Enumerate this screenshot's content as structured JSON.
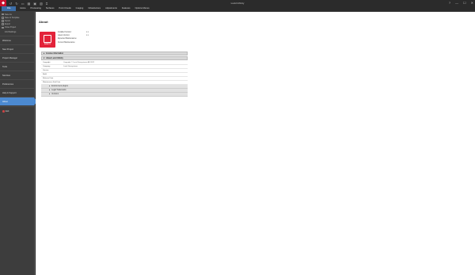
{
  "window": {
    "title": "Lucid Infinity"
  },
  "qat": [
    "↺",
    "↻",
    "▭",
    "▦",
    "▣",
    "▧",
    "⌗"
  ],
  "ribbon_tabs": [
    "File",
    "Home",
    "Processing",
    "Surfaces",
    "Point Clouds",
    "Imaging",
    "Infrastructure",
    "Adjustments",
    "Features",
    "Options Menus"
  ],
  "left": {
    "small_items": [
      "Save As",
      "Save to Template",
      "Import",
      "Export",
      "Close Project"
    ],
    "recent_label": "Info Buildings",
    "nav": [
      "Welcome",
      "New Project",
      "Project Manager",
      "Tools",
      "Services",
      "Preferences",
      "Help & Support",
      "About"
    ],
    "active": "About",
    "exit": "Exit"
  },
  "main": {
    "title": "About",
    "logo_text": "INFINITY",
    "versions": [
      {
        "label": "Installed Version:",
        "value": "x.x"
      },
      {
        "label": "Latest Version:",
        "value": "x.x"
      },
      {
        "label": "Expected Maintenance:",
        "value": ""
      },
      {
        "label": "Current Maintenance:",
        "value": ""
      }
    ],
    "section_license": "License information",
    "section_about": "About Lucid Infinity",
    "properties": [
      {
        "key": "Copyright",
        "value": "Copyright © Lucid Geosystems AB 2022"
      },
      {
        "key": "Company",
        "value": "Lucid Geosystems"
      },
      {
        "key": "Version",
        "value": ""
      },
      {
        "key": "Build",
        "value": ""
      },
      {
        "key": "Release Date",
        "value": ""
      },
      {
        "key": "Maintenance End Date",
        "value": ""
      }
    ],
    "subsections": [
      "Environment plugins",
      "Legal Trademarks",
      "Versions"
    ]
  }
}
